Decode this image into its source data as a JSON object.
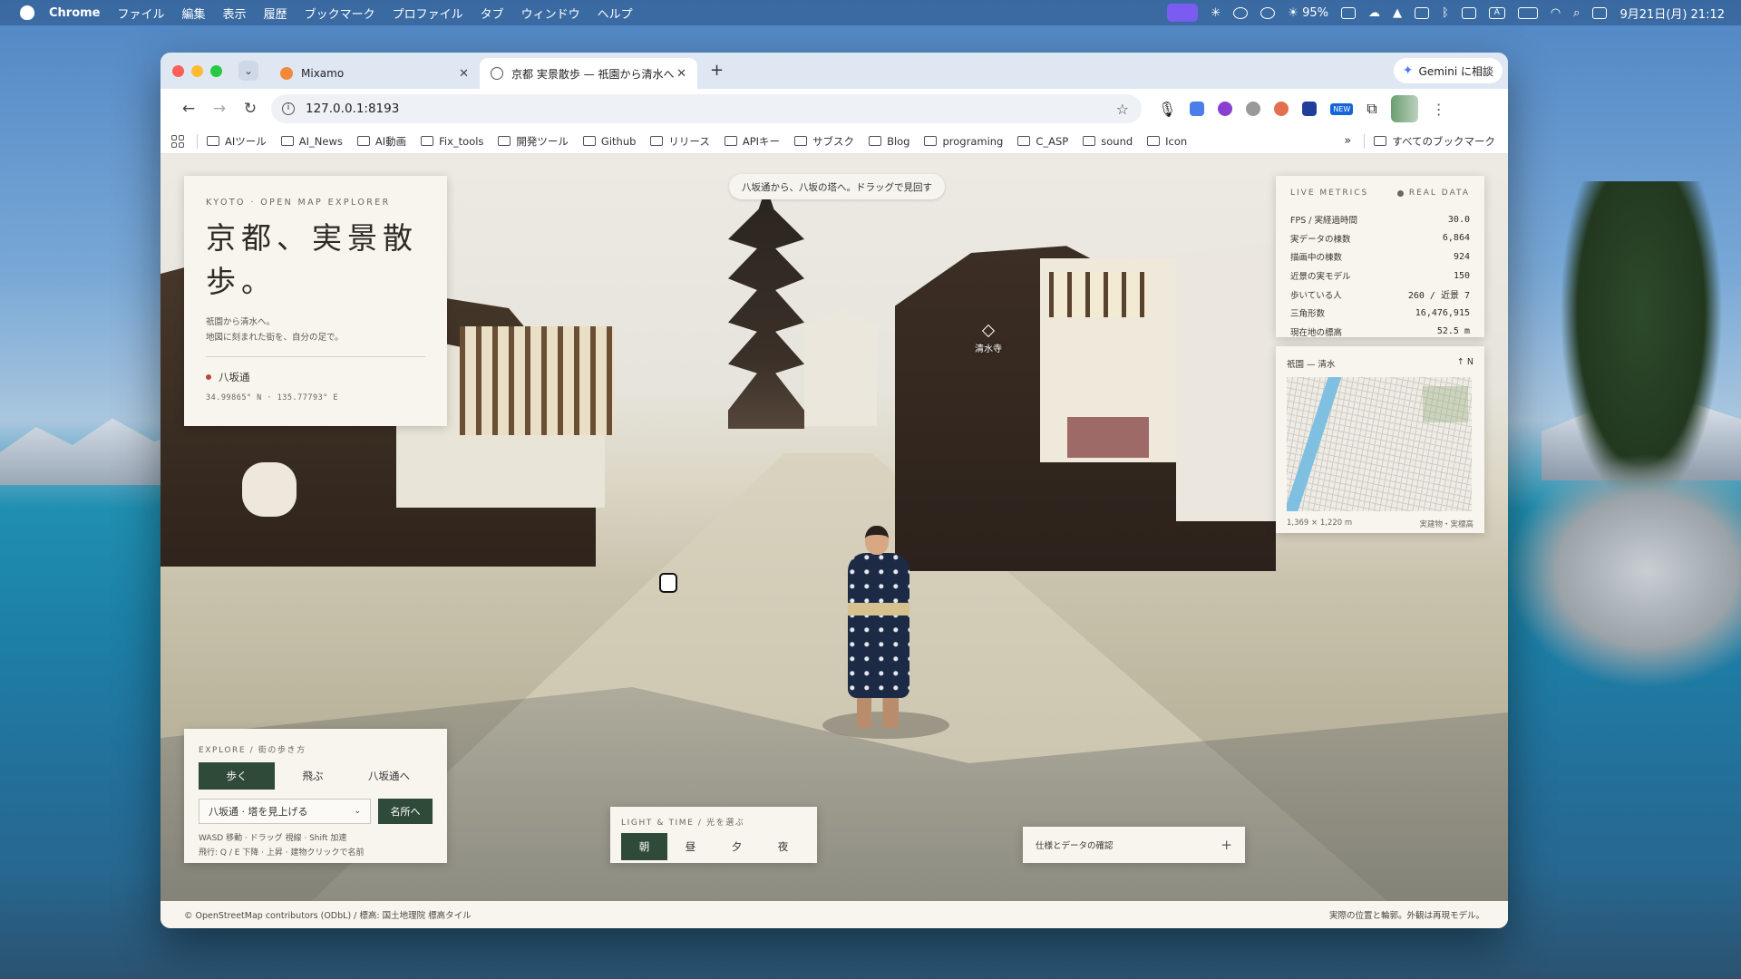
{
  "menubar": {
    "app": "Chrome",
    "items": [
      "ファイル",
      "編集",
      "表示",
      "履歴",
      "ブックマーク",
      "プロファイル",
      "タブ",
      "ウィンドウ",
      "ヘルプ"
    ],
    "battery": "95%",
    "datetime": "9月21日(月) 21:12",
    "input_badge": "A"
  },
  "browser": {
    "tabs": [
      {
        "title": "Mixamo"
      },
      {
        "title": "京都 実景散歩 — 祇園から清水へ"
      }
    ],
    "gemini": "Gemini に相談",
    "url": "127.0.0.1:8193",
    "ext_new_badge": "NEW",
    "bookmarks": [
      "AIツール",
      "AI_News",
      "AI動画",
      "Fix_tools",
      "開発ツール",
      "Github",
      "リリース",
      "APIキー",
      "サブスク",
      "Blog",
      "programing",
      "C_ASP",
      "sound",
      "Icon"
    ],
    "more": "»",
    "all_bookmarks": "すべてのブックマーク"
  },
  "app": {
    "tooltip": "八坂通から、八坂の塔へ。ドラッグで見回す",
    "landmark": "清水寺",
    "title_panel": {
      "kicker": "KYOTO · OPEN MAP EXPLORER",
      "title": "京都、実景散歩。",
      "sub1": "祇園から清水へ。",
      "sub2": "地図に刻まれた街を、自分の足で。",
      "location": "八坂通",
      "coords": "34.99865° N · 135.77793° E"
    },
    "metrics": {
      "header": "LIVE METRICS",
      "badge": "REAL DATA",
      "rows": [
        {
          "label": "FPS / 実経過時間",
          "value": "30.0"
        },
        {
          "label": "実データの棟数",
          "value": "6,864"
        },
        {
          "label": "描画中の棟数",
          "value": "924"
        },
        {
          "label": "近景の実モデル",
          "value": "150"
        },
        {
          "label": "歩いている人",
          "value": "260 / 近景 7"
        },
        {
          "label": "三角形数",
          "value": "16,476,915"
        },
        {
          "label": "現在地の標高",
          "value": "52.5 m"
        }
      ]
    },
    "map": {
      "title": "祇園 — 清水",
      "north": "↑ N",
      "size": "1,369 × 1,220 m",
      "source": "実建物・実標高"
    },
    "explore": {
      "kicker": "EXPLORE / 街の歩き方",
      "modes": [
        "歩く",
        "飛ぶ",
        "八坂通へ"
      ],
      "active_mode": 0,
      "select": "八坂通 · 塔を見上げる",
      "go": "名所へ",
      "help1": "WASD 移動 · ドラッグ 視線 · Shift 加速",
      "help2": "飛行: Q / E 下降 · 上昇 · 建物クリックで名前"
    },
    "light": {
      "kicker": "LIGHT & TIME / 光を選ぶ",
      "options": [
        "朝",
        "昼",
        "夕",
        "夜"
      ],
      "active": 0
    },
    "spec": {
      "label": "仕様とデータの確認",
      "plus": "+"
    },
    "footer": {
      "left": "© OpenStreetMap contributors (ODbL) / 標高: 国土地理院 標高タイル",
      "right": "実際の位置と輪郭。外観は再現モデル。"
    }
  }
}
